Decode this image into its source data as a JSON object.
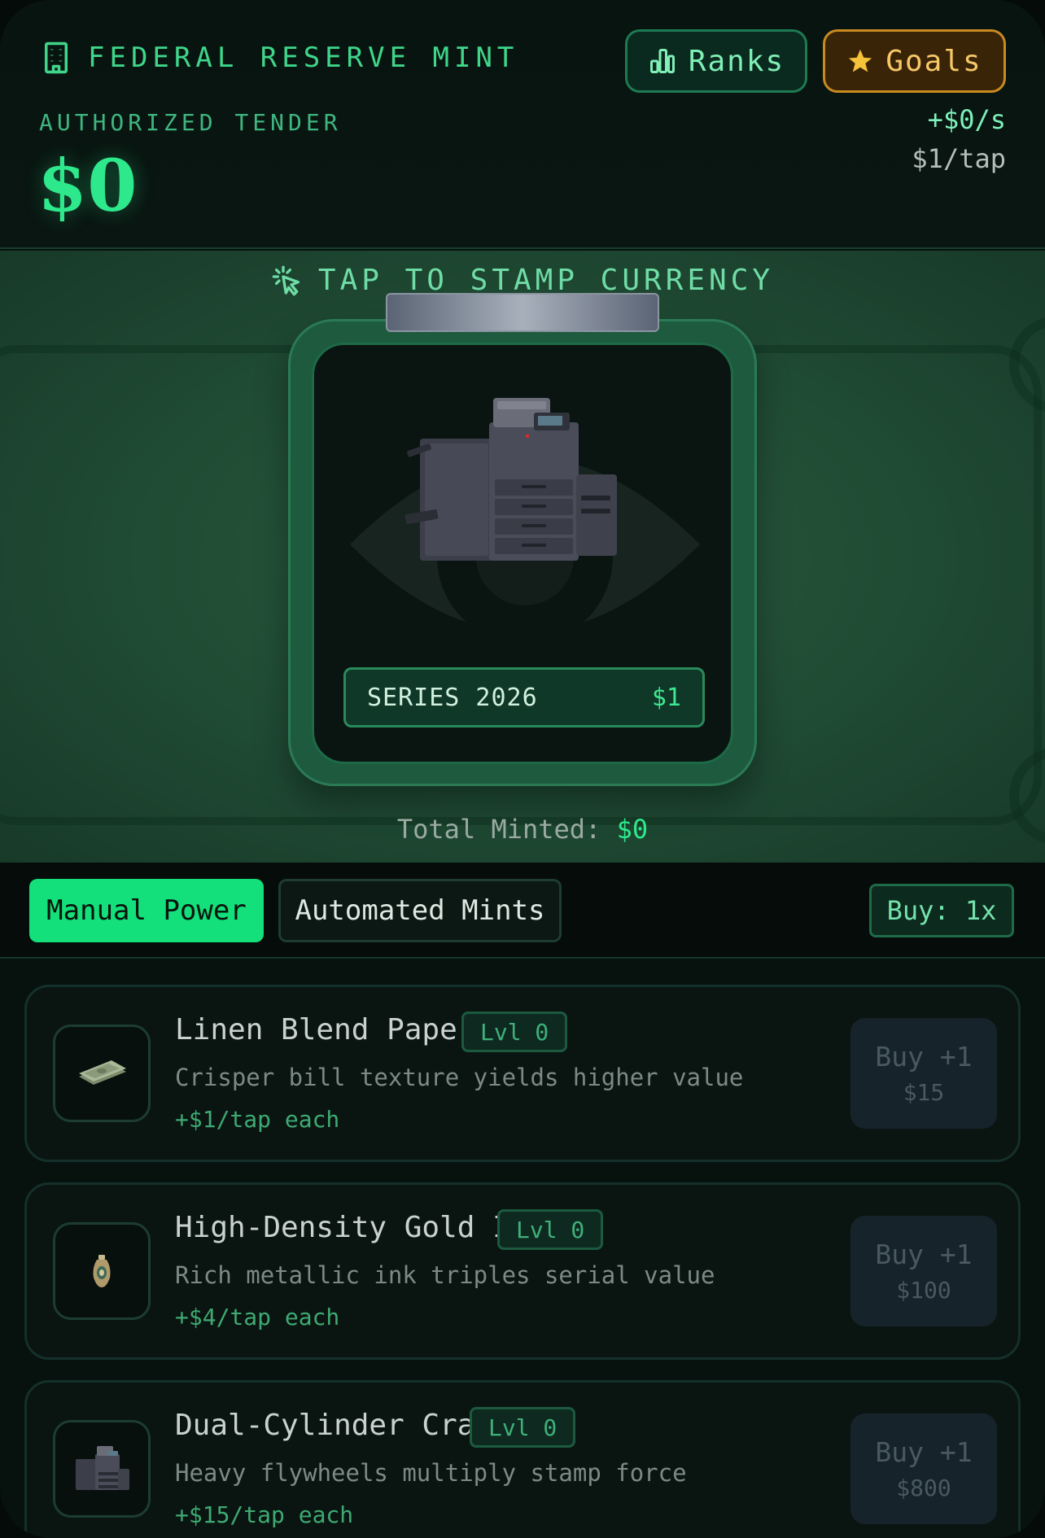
{
  "header": {
    "brand": "FEDERAL RESERVE MINT",
    "ranks_label": "Ranks",
    "goals_label": "Goals",
    "tender_label": "AUTHORIZED TENDER",
    "balance": "$0",
    "rate": "+$0/s",
    "per_tap": "$1/tap"
  },
  "stamp": {
    "hint": "TAP TO STAMP CURRENCY",
    "series_label": "SERIES 2026",
    "series_value": "$1",
    "total_label": "Total Minted:",
    "total_value": "$0"
  },
  "tabs": {
    "manual": "Manual Power",
    "automated": "Automated Mints",
    "buy_multiplier": "Buy: 1x"
  },
  "upgrades": [
    {
      "name": "Linen Blend Paper",
      "level": "Lvl 0",
      "desc": "Crisper bill texture yields higher value",
      "bonus": "+$1/tap each",
      "buy": "Buy +1",
      "cost": "$15",
      "icon": "cash-stack-icon"
    },
    {
      "name": "High-Density Gold Ink",
      "level": "Lvl 0",
      "desc": "Rich metallic ink triples serial value",
      "bonus": "+$4/tap each",
      "buy": "Buy +1",
      "cost": "$100",
      "icon": "ink-vase-icon"
    },
    {
      "name": "Dual-Cylinder Crank",
      "level": "Lvl 0",
      "desc": "Heavy flywheels multiply stamp force",
      "bonus": "+$15/tap each",
      "buy": "Buy +1",
      "cost": "$800",
      "icon": "printer-icon"
    }
  ],
  "colors": {
    "accent": "#13e07a",
    "gold": "#c98a20",
    "background": "#07110e"
  }
}
